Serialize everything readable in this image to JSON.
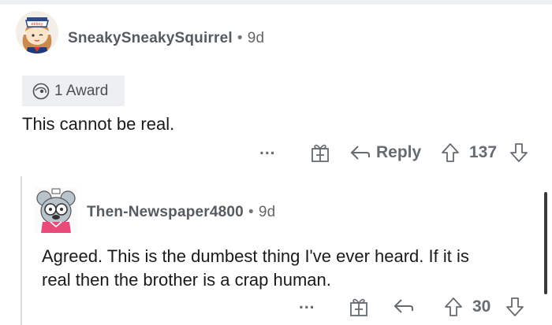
{
  "comments": [
    {
      "username": "SneakySneakySquirrel",
      "separator": "•",
      "time": "9d",
      "award_label": "1 Award",
      "text": "This cannot be real.",
      "more_label": "...",
      "reply_label": "Reply",
      "score": "137",
      "avatar_hat_text": "ekboy"
    },
    {
      "username": "Then-Newspaper4800",
      "separator": "•",
      "time": "9d",
      "text_line1": "Agreed. This is the dumbest thing I've ever heard. If it is",
      "text_line2": "real then the brother is a crap human.",
      "more_label": "...",
      "score": "30"
    }
  ],
  "colors": {
    "meta_text": "#666b70",
    "award_bg": "#eeeff1",
    "thread_line": "#dcdcdc"
  },
  "icons": [
    "award-icon",
    "more-icon",
    "gift-icon",
    "reply-arrow-icon",
    "upvote-icon",
    "downvote-icon"
  ]
}
